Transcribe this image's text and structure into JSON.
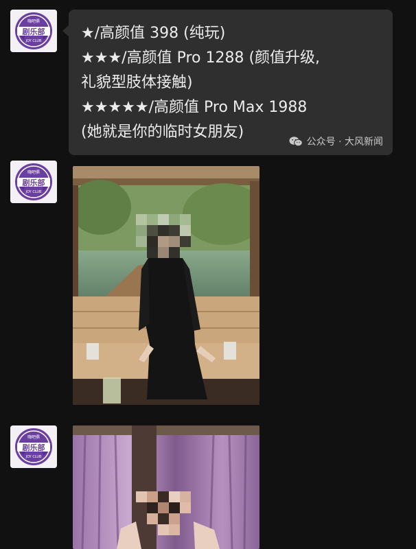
{
  "avatar": {
    "logo_top_text": "嗨吧俱",
    "logo_main_text": "剧乐部",
    "logo_bottom_text": "JOY CLUB"
  },
  "message": {
    "lines": [
      "★/高颜值 398 (纯玩)",
      "★★★/高颜值 Pro 1288 (颜值升级,",
      "礼貌型肢体接触)",
      "★★★★★/高颜值 Pro Max 1988",
      "(她就是你的临时女朋友)"
    ]
  },
  "watermark": {
    "text": "公众号 · 大风新闻",
    "icon": "wechat-icon"
  },
  "colors": {
    "background": "#111111",
    "bubble": "#2f2f2f",
    "avatar_purple": "#6b3fa0"
  }
}
